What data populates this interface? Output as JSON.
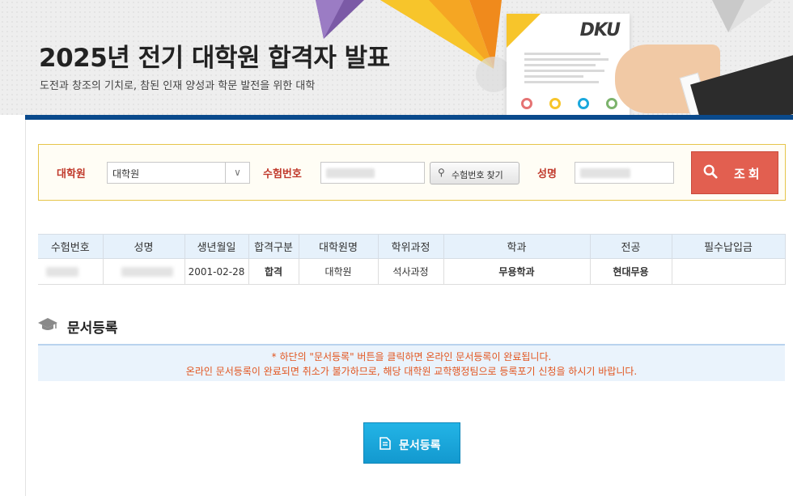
{
  "header": {
    "title": "2025년 전기 대학원 합격자 발표",
    "subtitle": "도전과 창조의 기치로, 참된 인재 양성과 학문 발전을 위한 대학",
    "logo_text": "DKU"
  },
  "search": {
    "graduate_label": "대학원",
    "graduate_value": "대학원",
    "exam_no_label": "수험번호",
    "find_exam_no_label": "수험번호 찾기",
    "name_label": "성명",
    "submit_label": "조회"
  },
  "results": {
    "columns": [
      "수험번호",
      "성명",
      "생년월일",
      "합격구분",
      "대학원명",
      "학위과정",
      "학과",
      "전공",
      "필수납입금"
    ],
    "rows": [
      {
        "exam_no": "",
        "name": "",
        "birth": "2001-02-28",
        "status": "합격",
        "graduate": "대학원",
        "degree": "석사과정",
        "department": "무용학과",
        "major": "현대무용",
        "fee": ""
      }
    ]
  },
  "document": {
    "title": "문서등록",
    "notice_line1": "* 하단의 \"문서등록\" 버튼을 클릭하면 온라인 문서등록이 완료됩니다.",
    "notice_line2": "온라인 문서등록이 완료되면 취소가 불가하므로, 해당 대학원 교학행정팀으로 등록포기 신청을 하시기 바랍니다.",
    "button_label": "문서등록"
  },
  "colors": {
    "accent_navy": "#0a4a8c",
    "search_red": "#e25f50",
    "label_red": "#c0392b",
    "pass_red": "#d32f2f",
    "notice_orange": "#e2551f",
    "doc_button_blue": "#1aa8dd"
  },
  "icons": {
    "search_small": "search-icon",
    "search_large": "search-icon",
    "select_arrow": "chevron-down-icon",
    "section": "graduation-cap-icon",
    "doc_button": "document-icon"
  }
}
